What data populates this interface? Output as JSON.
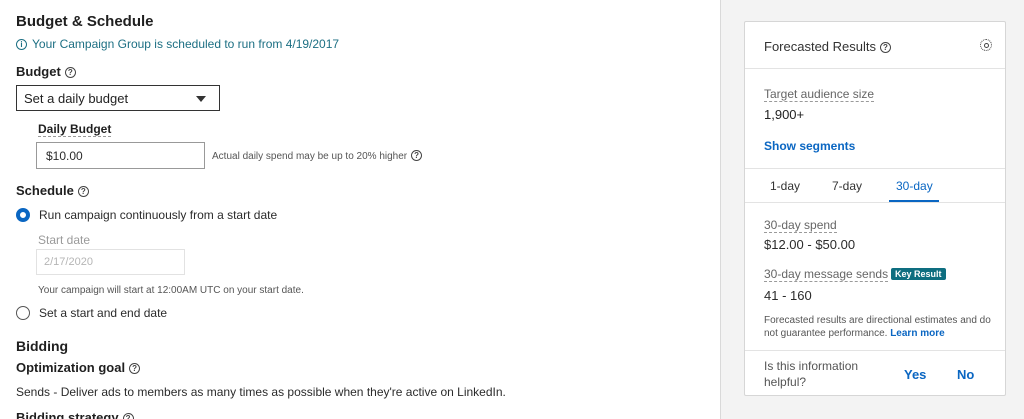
{
  "budget_schedule": {
    "title": "Budget & Schedule",
    "info_text": "Your Campaign Group is scheduled to run from 4/19/2017",
    "budget_label": "Budget",
    "budget_select_value": "Set a daily budget",
    "daily_budget_label": "Daily Budget",
    "daily_budget_value": "$10.00",
    "daily_budget_hint": "Actual daily spend may be up to 20% higher",
    "schedule_label": "Schedule",
    "radio_continuous": "Run campaign continuously from a start date",
    "start_date_label": "Start date",
    "start_date_value": "2/17/2020",
    "start_date_hint": "Your campaign will start at 12:00AM UTC on your start date.",
    "radio_start_end": "Set a start and end date"
  },
  "bidding": {
    "title": "Bidding",
    "optimization_goal_label": "Optimization goal",
    "optimization_goal_text": "Sends - Deliver ads to members as many times as possible when they're active on LinkedIn.",
    "bidding_strategy_label": "Bidding strategy"
  },
  "forecast": {
    "title": "Forecasted Results",
    "audience_label": "Target audience size",
    "audience_value": "1,900+",
    "show_segments": "Show segments",
    "tabs": [
      "1-day",
      "7-day",
      "30-day"
    ],
    "active_tab": "30-day",
    "spend_label": "30-day spend",
    "spend_value": "$12.00 - $50.00",
    "sends_label": "30-day message sends",
    "key_result_badge": "Key Result",
    "sends_value": "41 - 160",
    "disclaimer_line1": "Forecasted results are directional estimates and do",
    "disclaimer_line2": "not guarantee performance.",
    "learn_more": "Learn more",
    "helpful_line1": "Is this information",
    "helpful_line2": "helpful?",
    "yes": "Yes",
    "no": "No"
  },
  "colors": {
    "accent": "#0a66c2",
    "badge": "#0e6e80",
    "panel_bg": "#f3f3f3"
  },
  "icons": [
    "info-icon",
    "help-icon",
    "chevron-down-icon",
    "gear-icon"
  ]
}
